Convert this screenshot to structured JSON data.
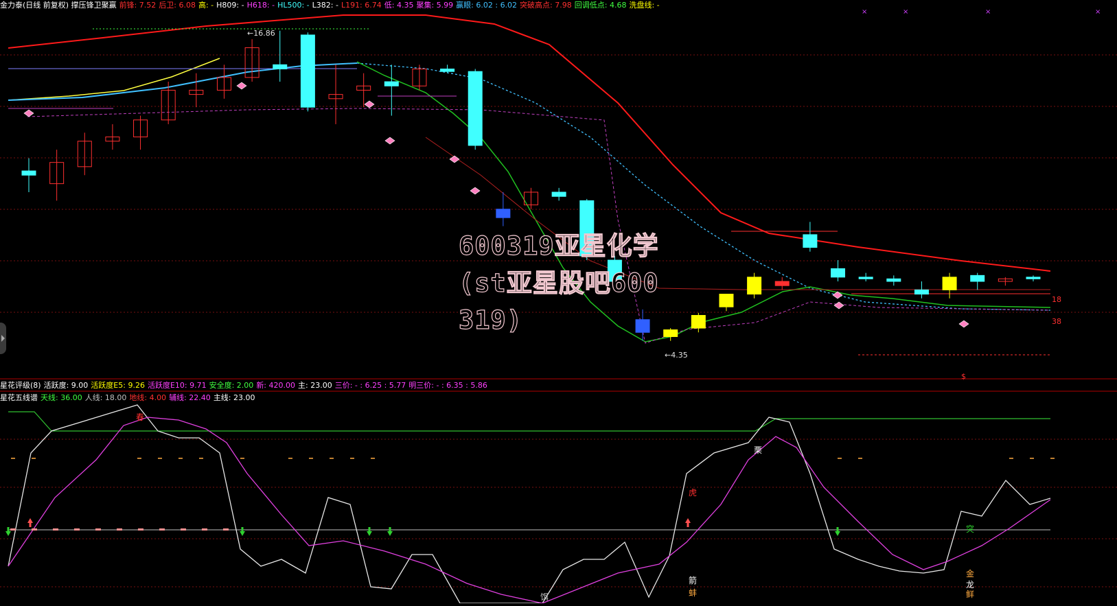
{
  "header_top": [
    {
      "text": "金力泰(日线 前复权) 撑压锋卫聚赢",
      "color": "#ffffff"
    },
    {
      "text": "前锋: 7.52",
      "color": "#ff3030"
    },
    {
      "text": "后卫: 6.08",
      "color": "#ff3030"
    },
    {
      "text": "高: -",
      "color": "#ffff00"
    },
    {
      "text": "H809: -",
      "color": "#ffffff"
    },
    {
      "text": "H618: -",
      "color": "#ff40ff"
    },
    {
      "text": "HL500: -",
      "color": "#40ffff"
    },
    {
      "text": "L382: -",
      "color": "#ffffff"
    },
    {
      "text": "L191: 6.74",
      "color": "#ff3030"
    },
    {
      "text": "低: 4.35",
      "color": "#ff40ff"
    },
    {
      "text": "聚集: 5.99",
      "color": "#ff40ff"
    },
    {
      "text": "赢眼: 6.02 : 6.02",
      "color": "#40c0ff"
    },
    {
      "text": "突破高点: 7.98",
      "color": "#ff3030"
    },
    {
      "text": "回调低点: 4.68",
      "color": "#40ff40"
    },
    {
      "text": "洗盘线: -",
      "color": "#ffff00"
    }
  ],
  "header_ind1": [
    {
      "text": "星花评级(8)",
      "color": "#ffffff"
    },
    {
      "text": "活跃度: 9.00",
      "color": "#ffffff"
    },
    {
      "text": "活跃度E5: 9.26",
      "color": "#ffff00"
    },
    {
      "text": "活跃度E10: 9.71",
      "color": "#ff40ff"
    },
    {
      "text": "安全度: 2.00",
      "color": "#40ff40"
    },
    {
      "text": "新: 420.00",
      "color": "#ff40ff"
    },
    {
      "text": "主: 23.00",
      "color": "#ffffff"
    },
    {
      "text": "三价: - : 6.25 : 5.77",
      "color": "#ff40ff"
    },
    {
      "text": "明三价: - : 6.35 : 5.86",
      "color": "#ff40ff"
    }
  ],
  "header_ind2": [
    {
      "text": "星花五线谱",
      "color": "#ffffff"
    },
    {
      "text": "天线: 36.00",
      "color": "#40ff40"
    },
    {
      "text": "人线: 18.00",
      "color": "#c0c0c0"
    },
    {
      "text": "地线: 4.00",
      "color": "#ff3030"
    },
    {
      "text": "辅线: 22.40",
      "color": "#ff40ff"
    },
    {
      "text": "主线: 23.00",
      "color": "#ffffff"
    }
  ],
  "watermark": {
    "line1": "600319亚星化学",
    "line2": "(st亚星股吧600",
    "line3": "319)"
  },
  "chart_data": {
    "type": "candlestick",
    "price_annotations": {
      "high_label": "16.86",
      "low_label": "4.35",
      "right_upper": "18",
      "right_lower": "38",
      "bottom_marker": "$"
    },
    "candles": [
      {
        "o": 6.3,
        "h": 6.5,
        "l": 6.1,
        "c": 6.35,
        "color": "#40ffff"
      },
      {
        "o": 6.2,
        "h": 6.6,
        "l": 6.0,
        "c": 6.45,
        "color": "#ff3030"
      },
      {
        "o": 6.4,
        "h": 6.8,
        "l": 6.3,
        "c": 6.7,
        "color": "#ff3030"
      },
      {
        "o": 6.7,
        "h": 6.9,
        "l": 6.6,
        "c": 6.75,
        "color": "#ff3030"
      },
      {
        "o": 6.75,
        "h": 7.0,
        "l": 6.6,
        "c": 6.95,
        "color": "#ff3030"
      },
      {
        "o": 6.95,
        "h": 7.4,
        "l": 6.9,
        "c": 7.3,
        "color": "#ff3030"
      },
      {
        "o": 7.25,
        "h": 7.5,
        "l": 7.1,
        "c": 7.3,
        "color": "#ff3030"
      },
      {
        "o": 7.3,
        "h": 7.6,
        "l": 7.2,
        "c": 7.45,
        "color": "#ff3030"
      },
      {
        "o": 7.45,
        "h": 7.9,
        "l": 7.4,
        "c": 7.8,
        "color": "#ff3030"
      },
      {
        "o": 7.6,
        "h": 8.0,
        "l": 7.4,
        "c": 7.55,
        "color": "#40ffff"
      },
      {
        "o": 7.95,
        "h": 7.98,
        "l": 7.05,
        "c": 7.1,
        "color": "#40ffff"
      },
      {
        "o": 7.2,
        "h": 7.6,
        "l": 6.9,
        "c": 7.25,
        "color": "#ff3030"
      },
      {
        "o": 7.3,
        "h": 7.5,
        "l": 7.1,
        "c": 7.35,
        "color": "#ff3030"
      },
      {
        "o": 7.4,
        "h": 7.6,
        "l": 7.0,
        "c": 7.35,
        "color": "#40ffff"
      },
      {
        "o": 7.35,
        "h": 7.6,
        "l": 7.3,
        "c": 7.55,
        "color": "#ff3030"
      },
      {
        "o": 7.55,
        "h": 7.6,
        "l": 7.5,
        "c": 7.52,
        "color": "#40ffff"
      },
      {
        "o": 7.52,
        "h": 7.55,
        "l": 6.6,
        "c": 6.65,
        "color": "#40ffff"
      },
      {
        "o": 5.9,
        "h": 6.1,
        "l": 5.7,
        "c": 5.8,
        "color": "#3060ff"
      },
      {
        "o": 5.95,
        "h": 6.15,
        "l": 5.9,
        "c": 6.1,
        "color": "#ff3030"
      },
      {
        "o": 6.1,
        "h": 6.15,
        "l": 6.0,
        "c": 6.05,
        "color": "#40ffff"
      },
      {
        "o": 6.0,
        "h": 6.02,
        "l": 5.3,
        "c": 5.35,
        "color": "#40ffff"
      },
      {
        "o": 5.3,
        "h": 5.35,
        "l": 5.0,
        "c": 5.05,
        "color": "#40ffff"
      },
      {
        "o": 4.6,
        "h": 4.72,
        "l": 4.35,
        "c": 4.45,
        "color": "#3060ff"
      },
      {
        "o": 4.4,
        "h": 4.5,
        "l": 4.35,
        "c": 4.48,
        "color": "#ffff00"
      },
      {
        "o": 4.5,
        "h": 4.68,
        "l": 4.45,
        "c": 4.65,
        "color": "#ffff00"
      },
      {
        "o": 4.75,
        "h": 4.9,
        "l": 4.7,
        "c": 4.9,
        "color": "#ffff00"
      },
      {
        "o": 4.9,
        "h": 5.15,
        "l": 4.85,
        "c": 5.1,
        "color": "#ffff00"
      },
      {
        "o": 5.05,
        "h": 5.1,
        "l": 4.95,
        "c": 5.0,
        "color": "#ff3030"
      },
      {
        "o": 5.6,
        "h": 5.75,
        "l": 5.4,
        "c": 5.45,
        "color": "#40ffff"
      },
      {
        "o": 5.2,
        "h": 5.3,
        "l": 5.05,
        "c": 5.1,
        "color": "#40ffff"
      },
      {
        "o": 5.1,
        "h": 5.15,
        "l": 5.05,
        "c": 5.08,
        "color": "#40ffff"
      },
      {
        "o": 5.08,
        "h": 5.12,
        "l": 5.0,
        "c": 5.05,
        "color": "#40ffff"
      },
      {
        "o": 4.95,
        "h": 5.05,
        "l": 4.85,
        "c": 4.9,
        "color": "#40ffff"
      },
      {
        "o": 4.95,
        "h": 5.15,
        "l": 4.85,
        "c": 5.1,
        "color": "#ffff00"
      },
      {
        "o": 5.05,
        "h": 5.15,
        "l": 4.95,
        "c": 5.12,
        "color": "#40ffff"
      },
      {
        "o": 5.05,
        "h": 5.1,
        "l": 5.0,
        "c": 5.08,
        "color": "#ff3030"
      },
      {
        "o": 5.08,
        "h": 5.12,
        "l": 5.05,
        "c": 5.1,
        "color": "#40ffff"
      }
    ],
    "indicator_lines": {
      "tianxian": 36,
      "renxian": 18,
      "dixian": 4,
      "fuxian": 22.4,
      "zhuxian": 23
    },
    "indicator_labels": [
      "春",
      "栗",
      "虎",
      "箭",
      "蚌",
      "饵",
      "金",
      "龙",
      "鲜",
      "突"
    ]
  }
}
